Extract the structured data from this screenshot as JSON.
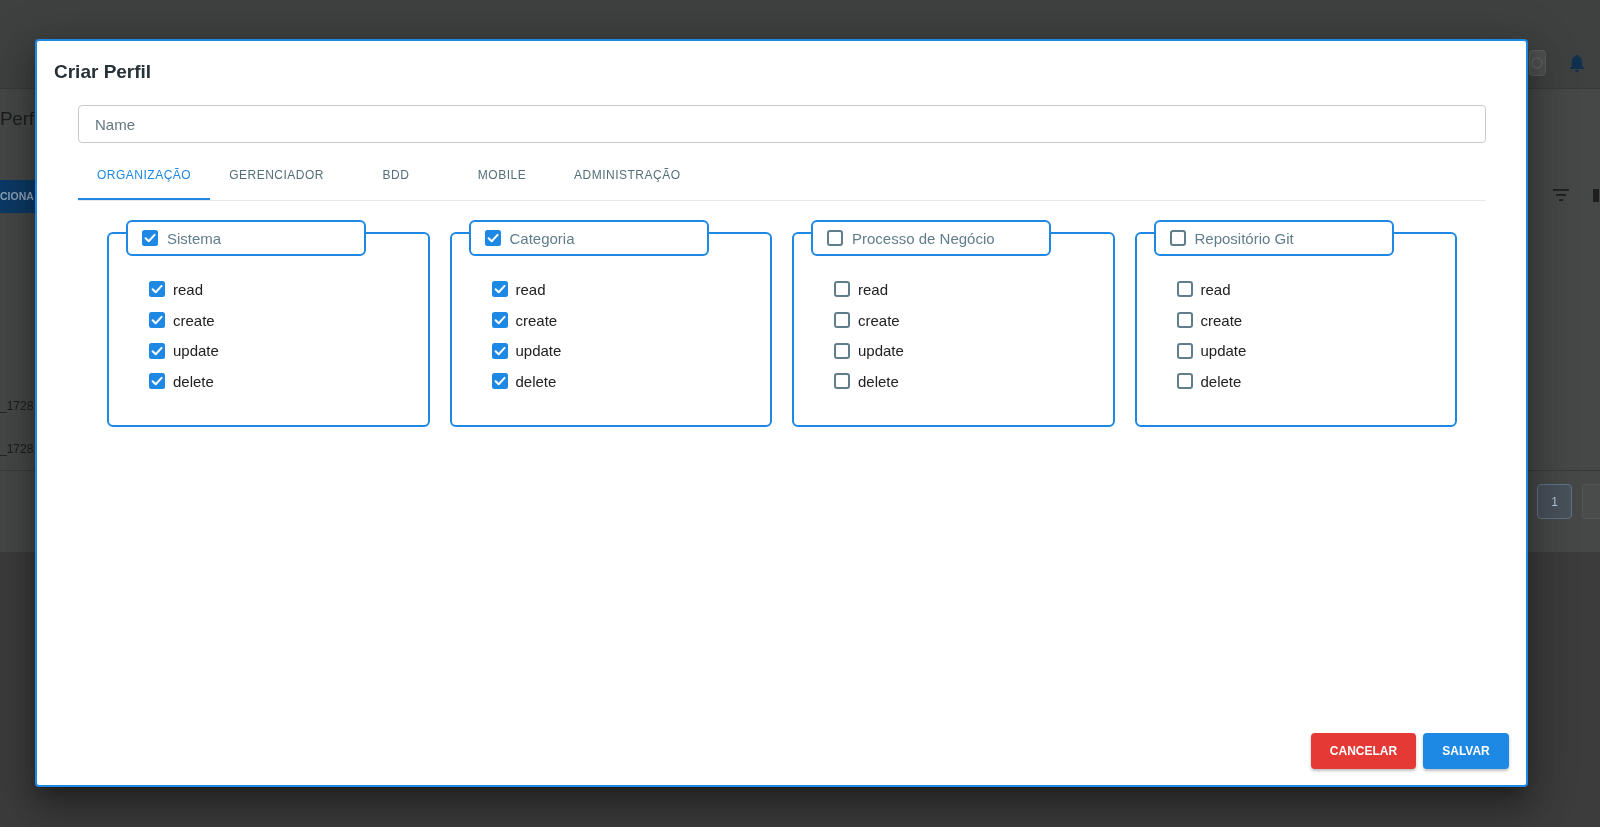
{
  "background_page": {
    "title": "Perf",
    "action_button": "CIONA",
    "rows": [
      "_1728",
      "_1728"
    ],
    "pagination": {
      "current_page": "1"
    }
  },
  "dialog": {
    "title": "Criar Perfil",
    "name_field": {
      "placeholder": "Name"
    },
    "tabs": [
      {
        "label": "ORGANIZAÇÃO",
        "selected": true
      },
      {
        "label": "GERENCIADOR",
        "selected": false
      },
      {
        "label": "BDD",
        "selected": false
      },
      {
        "label": "MOBILE",
        "selected": false
      },
      {
        "label": "ADMINISTRAÇÃO",
        "selected": false
      }
    ],
    "groups": [
      {
        "label": "Sistema",
        "checked": true,
        "permissions": [
          {
            "label": "read",
            "checked": true
          },
          {
            "label": "create",
            "checked": true
          },
          {
            "label": "update",
            "checked": true
          },
          {
            "label": "delete",
            "checked": true
          }
        ]
      },
      {
        "label": "Categoria",
        "checked": true,
        "permissions": [
          {
            "label": "read",
            "checked": true
          },
          {
            "label": "create",
            "checked": true
          },
          {
            "label": "update",
            "checked": true
          },
          {
            "label": "delete",
            "checked": true
          }
        ]
      },
      {
        "label": "Processo de Negócio",
        "checked": false,
        "permissions": [
          {
            "label": "read",
            "checked": false
          },
          {
            "label": "create",
            "checked": false
          },
          {
            "label": "update",
            "checked": false
          },
          {
            "label": "delete",
            "checked": false
          }
        ]
      },
      {
        "label": "Repositório Git",
        "checked": false,
        "permissions": [
          {
            "label": "read",
            "checked": false
          },
          {
            "label": "create",
            "checked": false
          },
          {
            "label": "update",
            "checked": false
          },
          {
            "label": "delete",
            "checked": false
          }
        ]
      }
    ],
    "buttons": [
      {
        "label": "CANCELAR",
        "kind": "cancel"
      },
      {
        "label": "SALVAR",
        "kind": "save"
      }
    ]
  }
}
